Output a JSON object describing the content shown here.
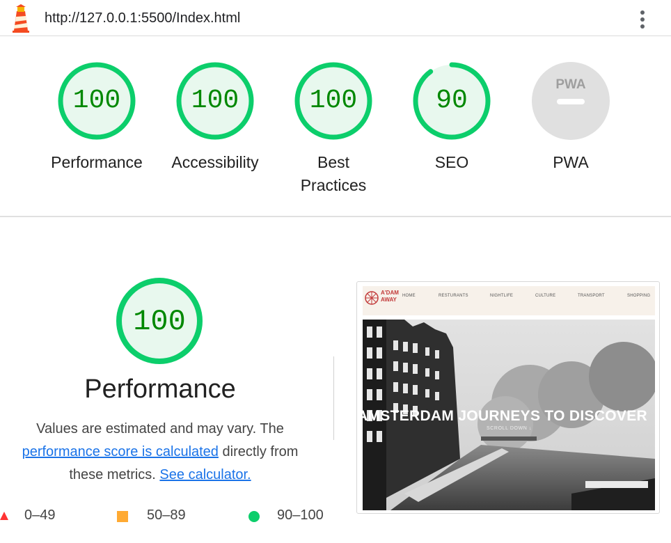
{
  "topbar": {
    "url": "http://127.0.0.1:5500/Index.html"
  },
  "gauges": [
    {
      "score": "100",
      "label": "Performance",
      "value": 100
    },
    {
      "score": "100",
      "label": "Accessibility",
      "value": 100
    },
    {
      "score": "100",
      "label": "Best Practices",
      "value": 100
    },
    {
      "score": "90",
      "label": "SEO",
      "value": 90
    },
    {
      "score": "PWA",
      "label": "PWA"
    }
  ],
  "performance": {
    "score": "100",
    "title": "Performance",
    "desc_part1": "Values are estimated and may vary. The",
    "link1": "performance score is calculated",
    "desc_part2": "directly from",
    "desc_part3": "these metrics.",
    "link2": "See calculator."
  },
  "legend": [
    {
      "range": "0–49",
      "color": "#ff3333",
      "shape": "triangle"
    },
    {
      "range": "50–89",
      "color": "#ffaa33",
      "shape": "square"
    },
    {
      "range": "90–100",
      "color": "#0cce6b",
      "shape": "circle"
    }
  ],
  "screenshot": {
    "brand_line1": "A'DAM",
    "brand_line2": "AWAY",
    "menu": [
      "HOME",
      "RESTURANTS",
      "NIGHTLIFE",
      "CULTURE",
      "TRANSPORT",
      "SHOPPING"
    ],
    "hero_title": "AMSTERDAM JOURNEYS TO DISCOVER",
    "hero_sub": "SCROLL DOWN ↓"
  },
  "colors": {
    "pass": "#0cce6b",
    "pass_text": "#008800",
    "pass_fill": "#e8f8ee",
    "link": "#1a73e8",
    "na": "#e0e0e0"
  }
}
